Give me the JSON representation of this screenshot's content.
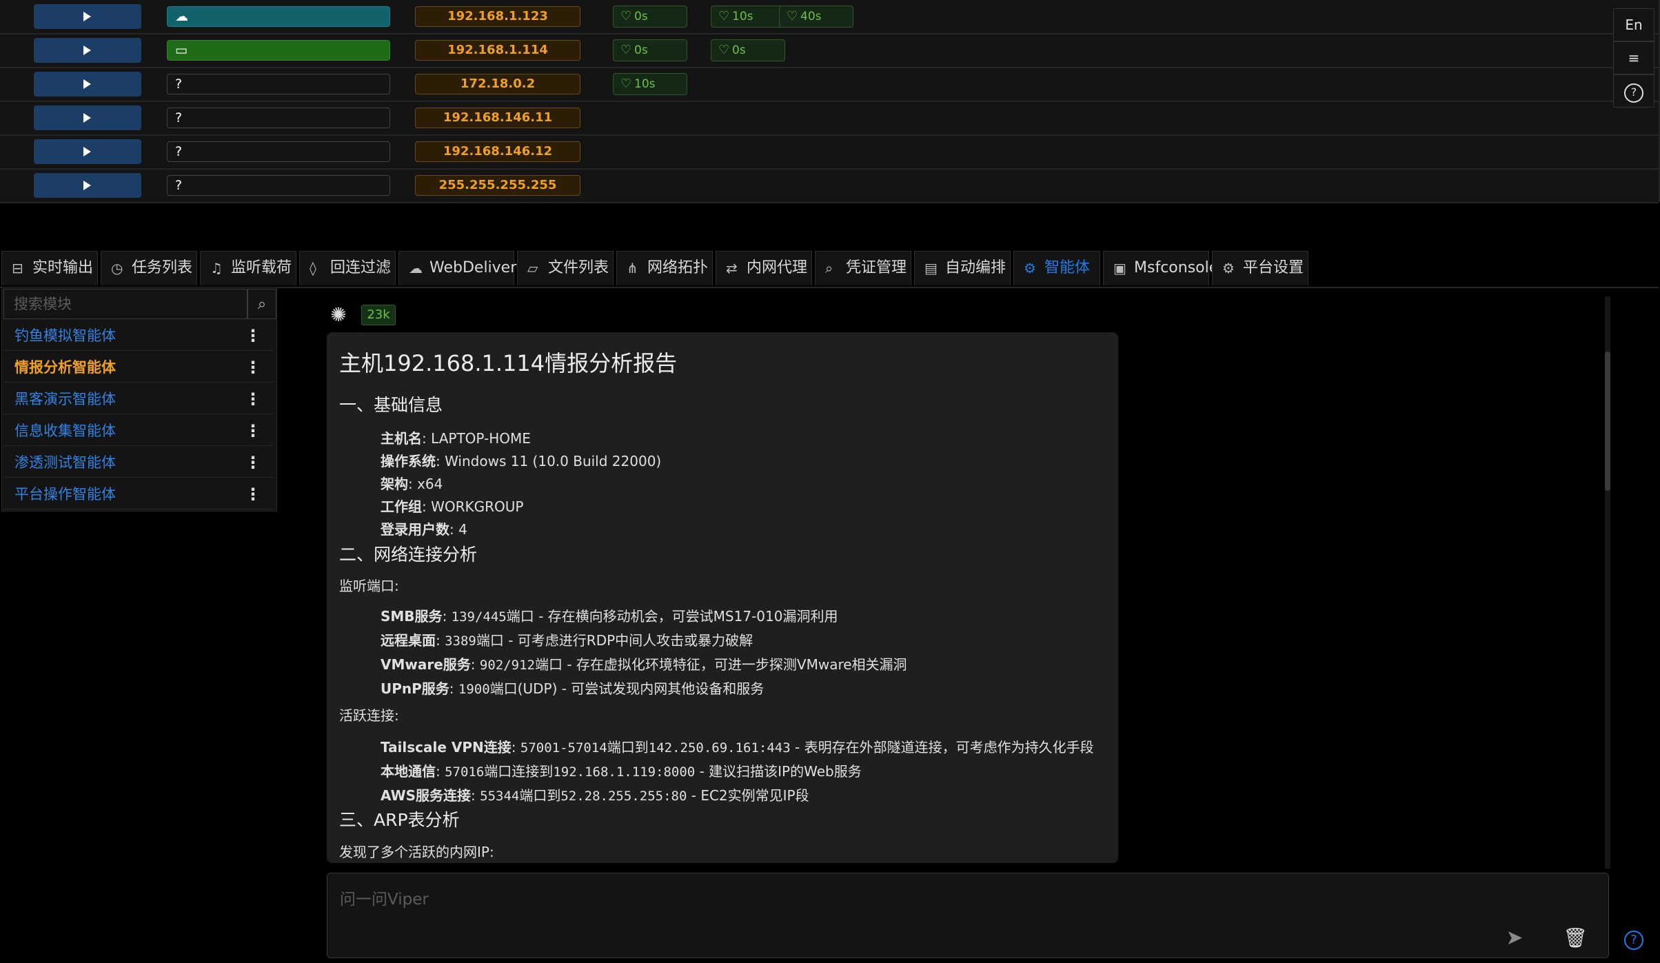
{
  "hosts": [
    {
      "tag_icon": "cloud-icon",
      "tag_glyph": "☁",
      "tag_text": "",
      "tag_color": "#11626b",
      "ip": "192.168.1.123",
      "heartbeats": [
        "0s",
        "10s",
        "40s"
      ]
    },
    {
      "tag_icon": "laptop-icon",
      "tag_glyph": "▭",
      "tag_text": "",
      "tag_color": "#1f6b17",
      "ip": "192.168.1.114",
      "heartbeats": [
        "0s",
        "0s"
      ]
    },
    {
      "tag_icon": "unknown-icon",
      "tag_glyph": "?",
      "tag_text": "",
      "tag_color": "#141414",
      "ip": "172.18.0.2",
      "heartbeats": [
        "10s"
      ]
    },
    {
      "tag_icon": "unknown-icon",
      "tag_glyph": "?",
      "tag_text": "",
      "tag_color": "#141414",
      "ip": "192.168.146.11",
      "heartbeats": []
    },
    {
      "tag_icon": "unknown-icon",
      "tag_glyph": "?",
      "tag_text": "",
      "tag_color": "#141414",
      "ip": "192.168.146.12",
      "heartbeats": []
    },
    {
      "tag_icon": "unknown-icon",
      "tag_glyph": "?",
      "tag_text": "",
      "tag_color": "#141414",
      "ip": "255.255.255.255",
      "heartbeats": []
    }
  ],
  "right_tools": {
    "lang": "En",
    "menu_icon": "≡",
    "help_icon": "?"
  },
  "tabs": [
    {
      "label": "实时输出",
      "icon": "output-icon",
      "glyph": "⊟"
    },
    {
      "label": "任务列表",
      "icon": "clock-icon",
      "glyph": "◷"
    },
    {
      "label": "监听载荷",
      "icon": "headphones-icon",
      "glyph": "♫"
    },
    {
      "label": "回连过滤",
      "icon": "fire-icon",
      "glyph": "◊"
    },
    {
      "label": "WebDelivery",
      "icon": "cloud-delivery-icon",
      "glyph": "☁"
    },
    {
      "label": "文件列表",
      "icon": "folder-icon",
      "glyph": "▱"
    },
    {
      "label": "网络拓扑",
      "icon": "topology-icon",
      "glyph": "⋔"
    },
    {
      "label": "内网代理",
      "icon": "proxy-icon",
      "glyph": "⇄"
    },
    {
      "label": "凭证管理",
      "icon": "key-icon",
      "glyph": "⌕"
    },
    {
      "label": "自动编排",
      "icon": "schedule-icon",
      "glyph": "▤"
    },
    {
      "label": "智能体",
      "icon": "agent-icon",
      "glyph": "⚙"
    },
    {
      "label": "Msfconsole",
      "icon": "terminal-icon",
      "glyph": "▣"
    },
    {
      "label": "平台设置",
      "icon": "gear-icon",
      "glyph": "⚙"
    }
  ],
  "active_tab": "智能体",
  "search": {
    "placeholder": "搜索模块"
  },
  "agents": [
    "钓鱼模拟智能体",
    "情报分析智能体",
    "黑客演示智能体",
    "信息收集智能体",
    "渗透测试智能体",
    "平台操作智能体"
  ],
  "active_agent": "情报分析智能体",
  "token_count": "23k",
  "report": {
    "title": "主机192.168.1.114情报分析报告",
    "s1": "一、基础信息",
    "basic": [
      {
        "k": "主机名",
        "v": ": LAPTOP-HOME"
      },
      {
        "k": "操作系统",
        "v": ": Windows 11 (10.0 Build 22000)"
      },
      {
        "k": "架构",
        "v": ": x64"
      },
      {
        "k": "工作组",
        "v": ": WORKGROUP"
      },
      {
        "k": "登录用户数",
        "v": ": 4"
      }
    ],
    "s2": "二、网络连接分析",
    "listen_label": "监听端口:",
    "ports": [
      {
        "k": "SMB服务",
        "sep": ": ",
        "code": "139/445",
        "rest": "端口 - 存在横向移动机会，可尝试MS17-010漏洞利用"
      },
      {
        "k": "远程桌面",
        "sep": ": ",
        "code": "3389",
        "rest": "端口 - 可考虑进行RDP中间人攻击或暴力破解"
      },
      {
        "k": "VMware服务",
        "sep": ": ",
        "code": "902/912",
        "rest": "端口 - 存在虚拟化环境特征，可进一步探测VMware相关漏洞"
      },
      {
        "k": "UPnP服务",
        "sep": ": ",
        "code": "1900",
        "rest": "端口(UDP) - 可尝试发现内网其他设备和服务"
      }
    ],
    "active_label": "活跃连接:",
    "conns": [
      {
        "k": "Tailscale VPN连接",
        "sep": ": ",
        "code": "57001-57014",
        "mid": "端口到",
        "code2": "142.250.69.161:443",
        "rest": " - 表明存在外部隧道连接，可考虑作为持久化手段"
      },
      {
        "k": "本地通信",
        "sep": ": ",
        "code": "57016",
        "mid": "端口连接到",
        "code2": "192.168.1.119:8000",
        "rest": " - 建议扫描该IP的Web服务"
      },
      {
        "k": "AWS服务连接",
        "sep": ": ",
        "code": "55344",
        "mid": "端口到",
        "code2": "52.28.255.255:80",
        "rest": " - EC2实例常见IP段"
      }
    ],
    "s3": "三、ARP表分析",
    "arp_text": "发现了多个活跃的内网IP:"
  },
  "chat_input": {
    "placeholder": "问一问Viper"
  },
  "colors": {
    "accent": "#1d7ce8",
    "ip_orange": "#f0a020",
    "heartbeat_green": "#6cc04a",
    "bg": "#000000",
    "panel": "#141414"
  }
}
